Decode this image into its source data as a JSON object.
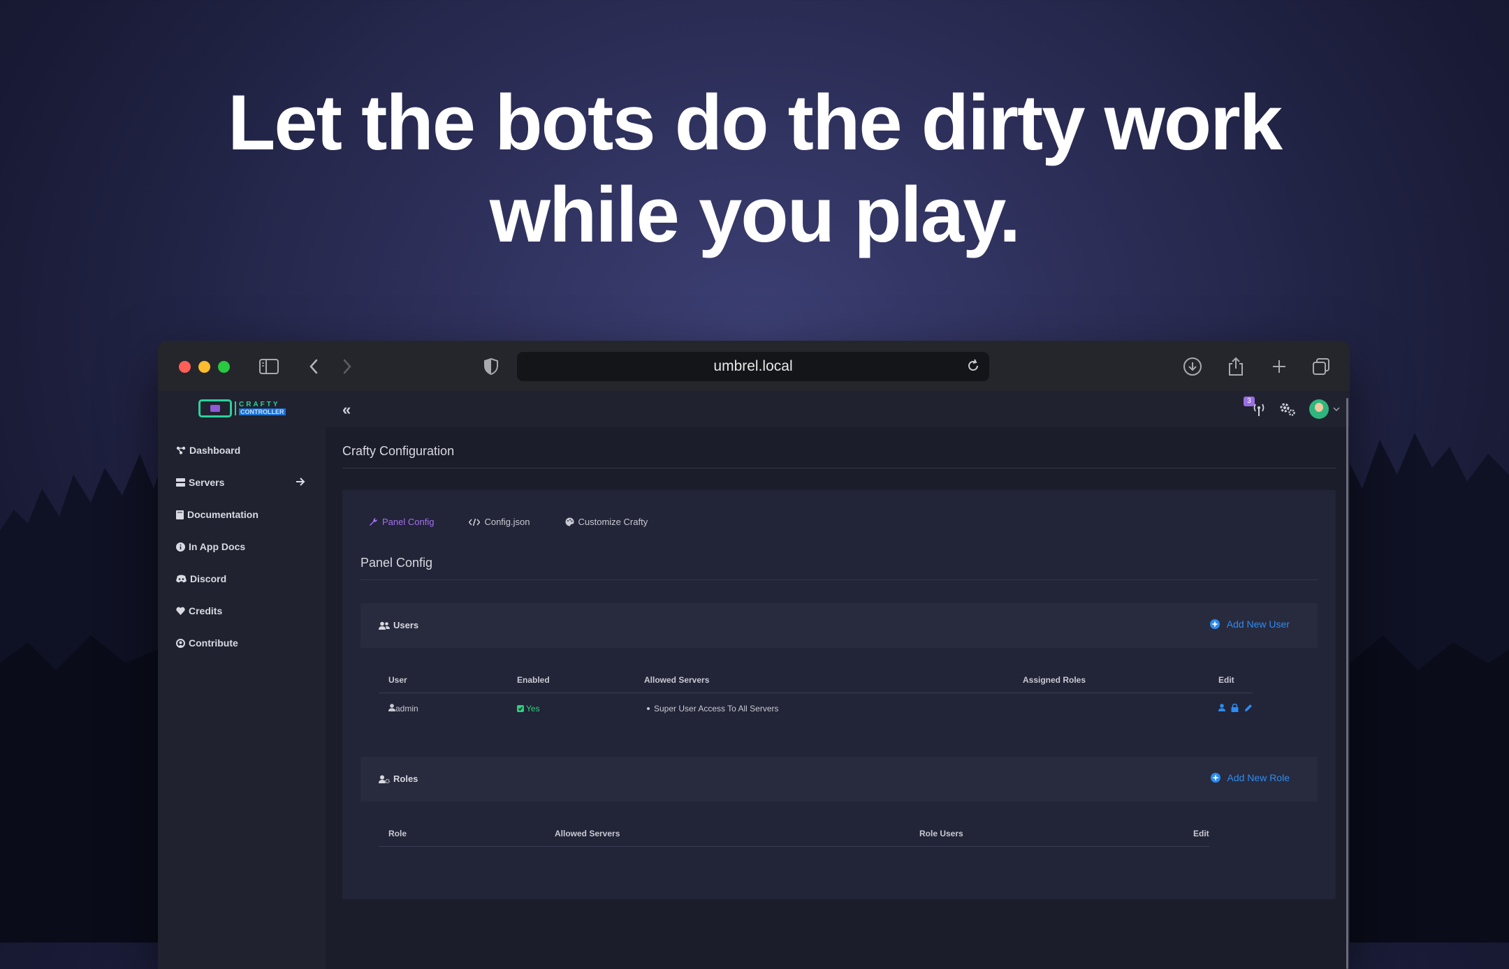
{
  "headline": {
    "line1": "Let the bots do the dirty work",
    "line2": "while you play."
  },
  "browser": {
    "url": "umbrel.local"
  },
  "sidebar": {
    "logo_line1": "CRAFTY",
    "logo_line2": "CONTROLLER",
    "items": [
      {
        "label": "Dashboard",
        "icon": "dashboard-icon"
      },
      {
        "label": "Servers",
        "icon": "servers-icon"
      },
      {
        "label": "Documentation",
        "icon": "book-icon"
      },
      {
        "label": "In App Docs",
        "icon": "info-icon"
      },
      {
        "label": "Discord",
        "icon": "discord-icon"
      },
      {
        "label": "Credits",
        "icon": "heart-icon"
      },
      {
        "label": "Contribute",
        "icon": "contribute-icon"
      }
    ]
  },
  "topbar": {
    "collapse": "«",
    "notification_count": "3"
  },
  "page": {
    "title": "Crafty Configuration"
  },
  "tabs": [
    {
      "label": "Panel Config",
      "icon": "wrench-icon",
      "active": true
    },
    {
      "label": "Config.json",
      "icon": "code-icon",
      "active": false
    },
    {
      "label": "Customize Crafty",
      "icon": "palette-icon",
      "active": false
    }
  ],
  "section": {
    "title": "Panel Config"
  },
  "users": {
    "title": "Users",
    "add_button": "Add New User",
    "columns": [
      "User",
      "Enabled",
      "Allowed Servers",
      "Assigned Roles",
      "Edit"
    ],
    "rows": [
      {
        "user": "admin",
        "enabled": "Yes",
        "allowed_servers": "Super User Access To All Servers",
        "assigned_roles": ""
      }
    ]
  },
  "roles": {
    "title": "Roles",
    "add_button": "Add New Role",
    "columns": [
      "Role",
      "Allowed Servers",
      "Role Users",
      "Edit"
    ]
  },
  "colors": {
    "accent": "#a272f0",
    "link": "#2d8cf0",
    "success": "#2fd07e",
    "background": "#1b1d2a"
  }
}
